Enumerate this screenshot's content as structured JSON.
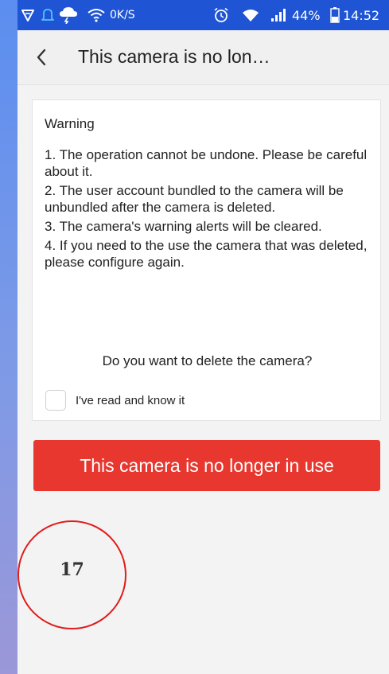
{
  "status_bar": {
    "network_speed": "0K/S",
    "battery_percent": "44%",
    "time": "14:52",
    "battery_level": 0.44,
    "icons": [
      "vpn-icon",
      "alarm-icon",
      "weather-cloud-icon",
      "wifi-icon",
      "alarm-clock-icon",
      "wifi-icon",
      "signal-icon",
      "battery-icon"
    ]
  },
  "header": {
    "title": "This camera is no lon…"
  },
  "warning": {
    "title": "Warning",
    "items": [
      "1. The operation cannot be undone. Please be careful about it.",
      "2. The user account bundled to the camera will be unbundled after the camera is deleted.",
      "3. The camera's warning alerts will be cleared.",
      "4. If you need to the use the camera that was deleted, please configure again."
    ],
    "question": "Do you want to delete the camera?",
    "checkbox_label": "I've read and know it",
    "checkbox_checked": false
  },
  "primary_button": {
    "label": "This camera is no longer in use"
  },
  "annotation": {
    "number": "17"
  },
  "colors": {
    "status_bar": "#1f55d4",
    "primary_button": "#e8372e",
    "annotation": "#e11b1b"
  }
}
